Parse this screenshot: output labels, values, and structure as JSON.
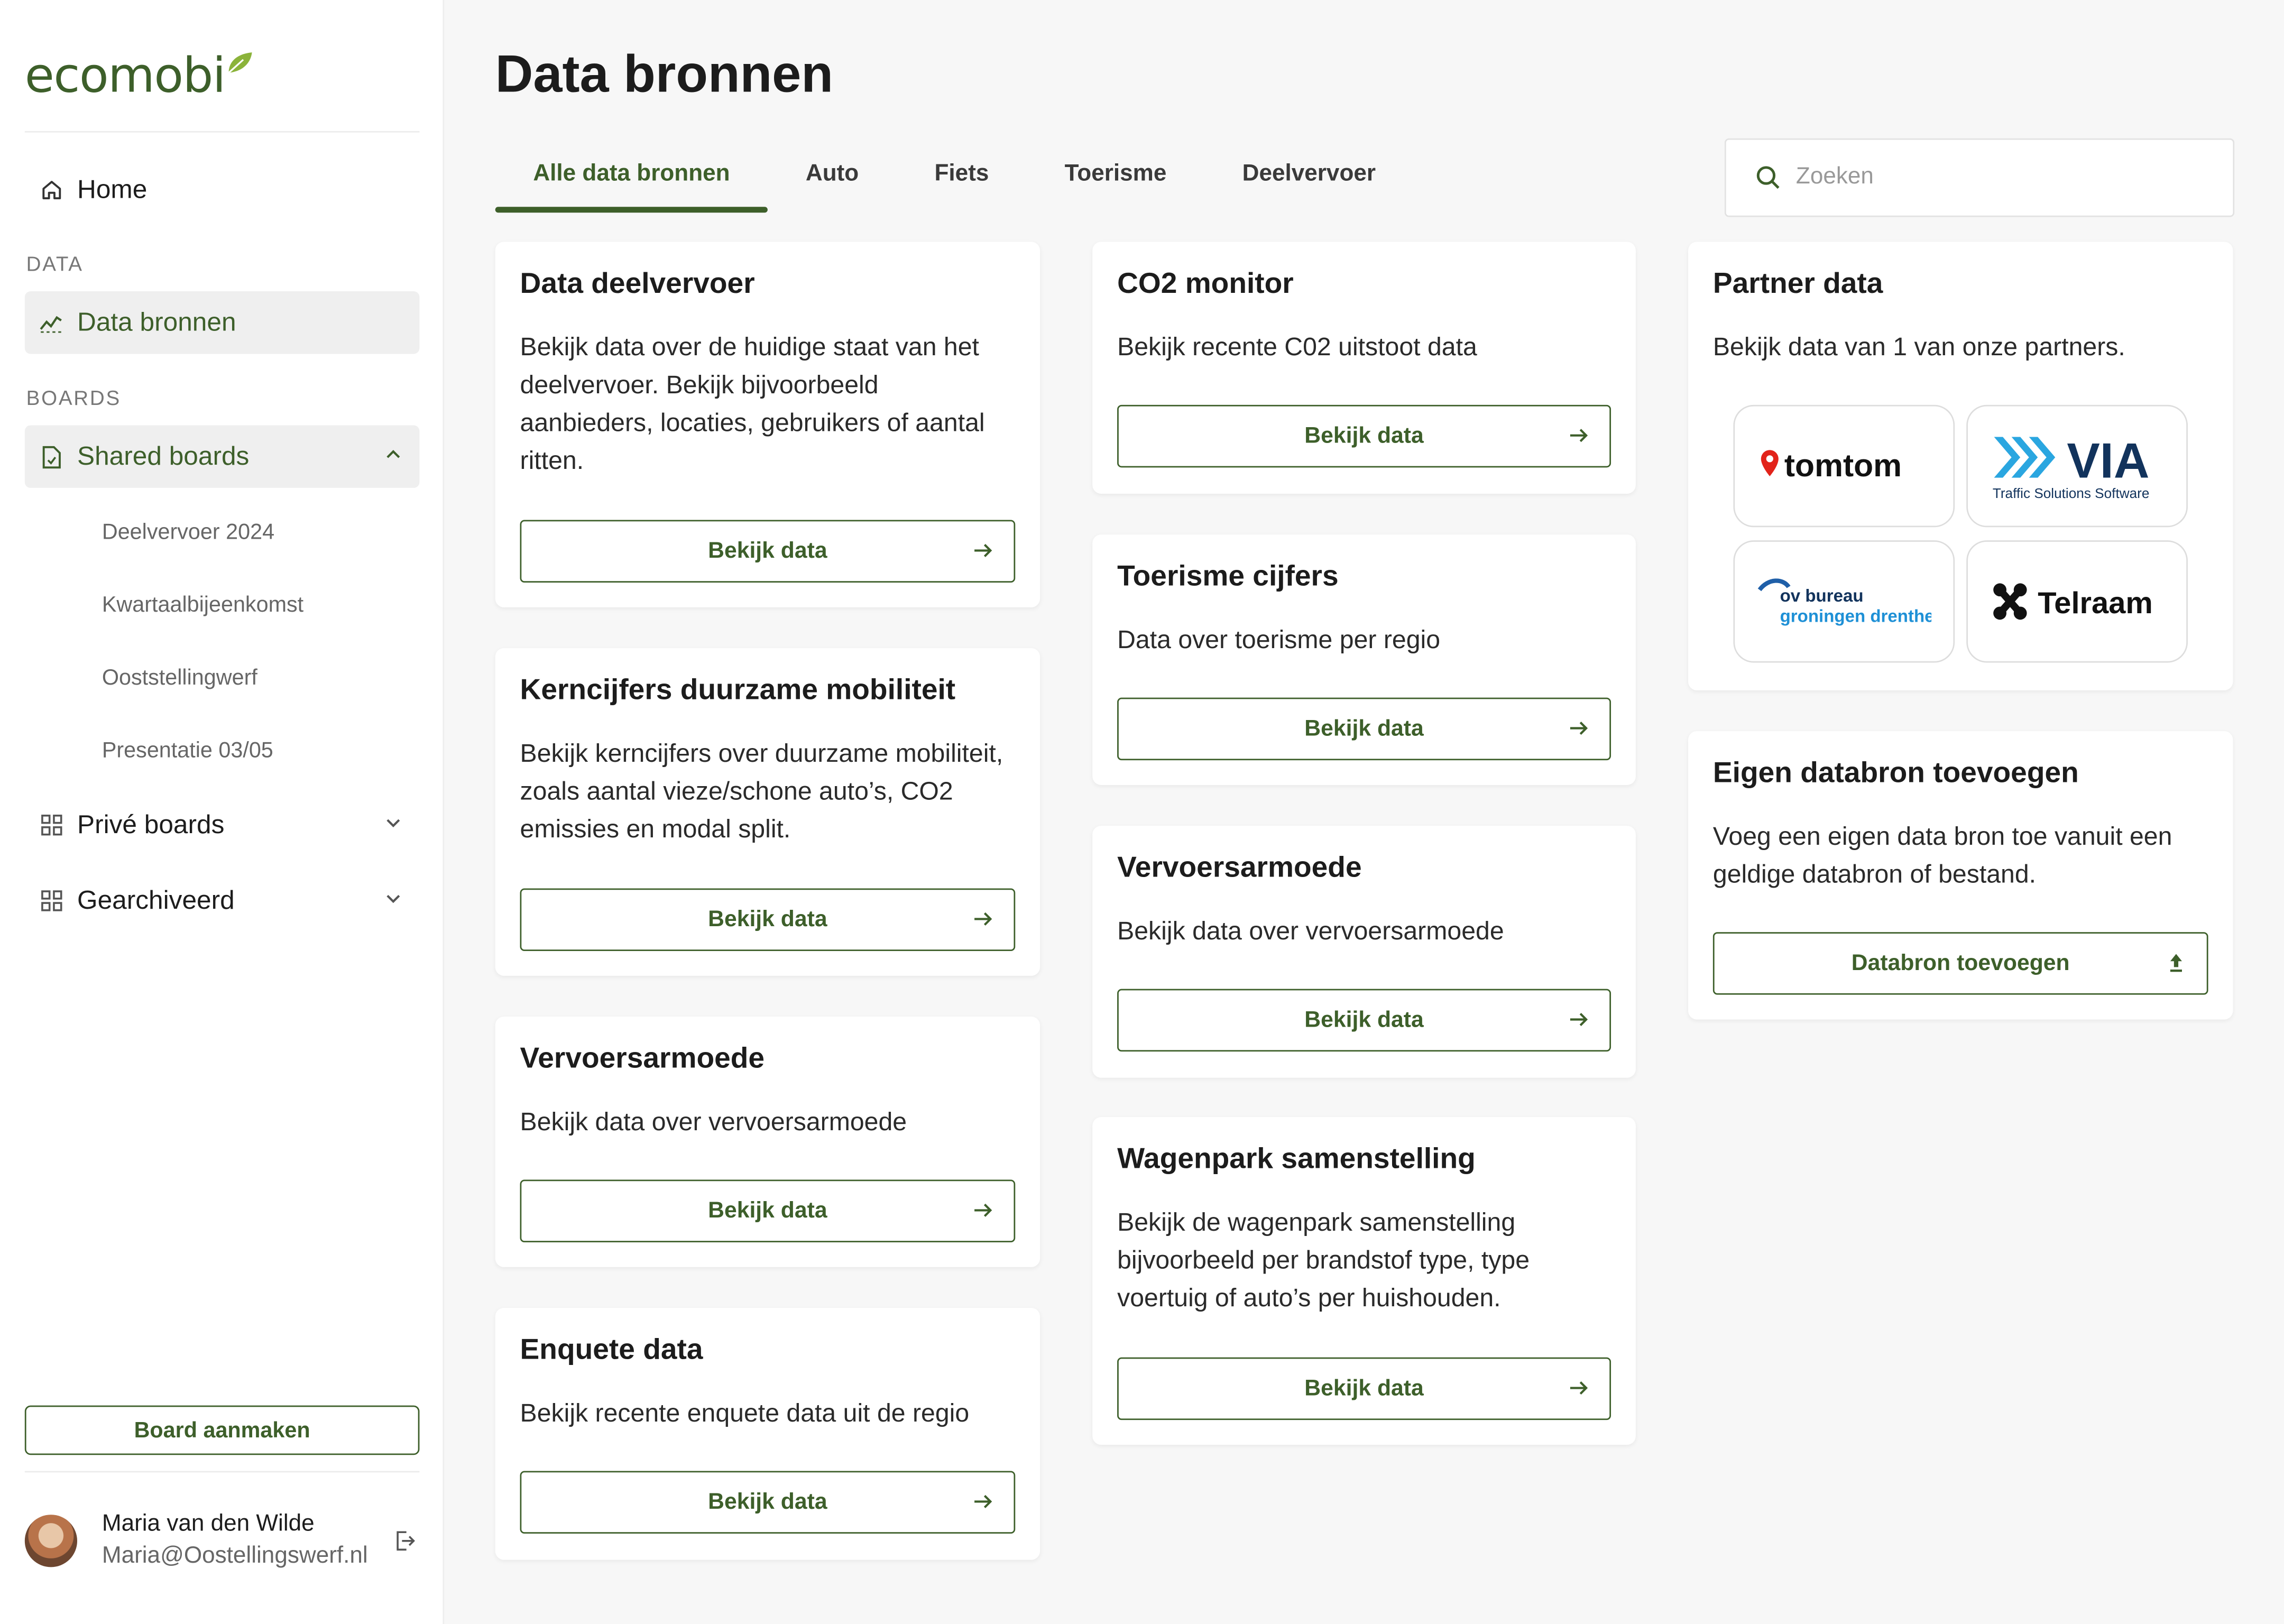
{
  "app": {
    "logo_text": "ecomobi"
  },
  "sidebar": {
    "home": "Home",
    "section_data": "DATA",
    "data_sources": "Data bronnen",
    "section_boards": "BOARDS",
    "shared_boards": "Shared boards",
    "shared_items": [
      "Deelvervoer 2024",
      "Kwartaalbijeenkomst",
      "Ooststellingwerf",
      "Presentatie 03/05"
    ],
    "private_boards": "Privé boards",
    "archived": "Gearchiveerd",
    "create_button": "Board aanmaken",
    "user_name": "Maria van den Wilde",
    "user_email": "Maria@Oostellingswerf.nl"
  },
  "main": {
    "title": "Data bronnen",
    "tabs": [
      "Alle data bronnen",
      "Auto",
      "Fiets",
      "Toerisme",
      "Deelvervoer"
    ],
    "search_placeholder": "Zoeken",
    "button_label": "Bekijk data",
    "cards": [
      {
        "title": "Data deelvervoer",
        "text": "Bekijk data over de huidige staat van het deelvervoer. Bekijk bijvoorbeeld aanbieders, locaties, gebruikers of aantal ritten."
      },
      {
        "title": "Kerncijfers duurzame mobiliteit",
        "text": "Bekijk kerncijfers over duurzame mobiliteit, zoals aantal vieze/schone auto’s, CO2 emissies en modal split."
      },
      {
        "title": "Vervoersarmoede",
        "text": "Bekijk data over vervoersarmoede"
      },
      {
        "title": "Enquete data",
        "text": "Bekijk recente enquete data uit de regio"
      },
      {
        "title": "CO2 monitor",
        "text": "Bekijk recente C02 uitstoot data"
      },
      {
        "title": "Toerisme cijfers",
        "text": "Data over toerisme per regio"
      },
      {
        "title": "Vervoersarmoede",
        "text": "Bekijk data over vervoersarmoede"
      },
      {
        "title": "Wagenpark samenstelling",
        "text": "Bekijk de wagenpark samenstelling bijvoorbeeld per brandstof type, type voertuig of auto’s per huishouden."
      }
    ],
    "partner": {
      "title": "Partner data",
      "text": "Bekijk data van 1 van onze partners.",
      "logos": {
        "tomtom": "tomtom",
        "via": "VIA",
        "via_sub": "Traffic Solutions Software",
        "ov_line1": "ov bureau",
        "ov_line2": "groningen drenthe",
        "telraam": "Telraam"
      }
    },
    "own_source": {
      "title": "Eigen databron toevoegen",
      "text": "Voeg een eigen data bron toe vanuit een geldige databron of bestand.",
      "button": "Databron toevoegen"
    }
  },
  "colors": {
    "accent": "#3d5f2a",
    "leaf": "#8bb33a"
  }
}
